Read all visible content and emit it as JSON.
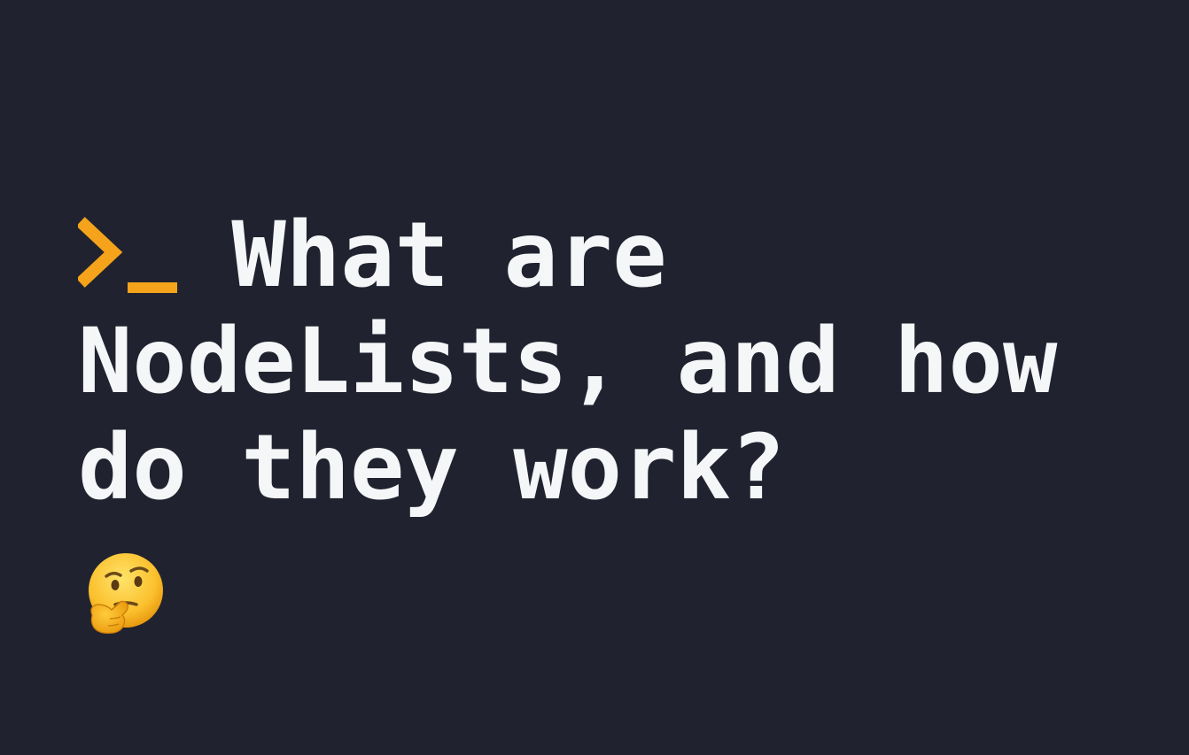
{
  "accent_color": "#f5a31a",
  "background_color": "#20232f",
  "text_color": "#f5f6f8",
  "prompt": ">_",
  "title": {
    "line1": "What are",
    "line2": "NodeLists, and how",
    "line3": "do they work?"
  },
  "emoji_icon": "thinking-face-icon"
}
